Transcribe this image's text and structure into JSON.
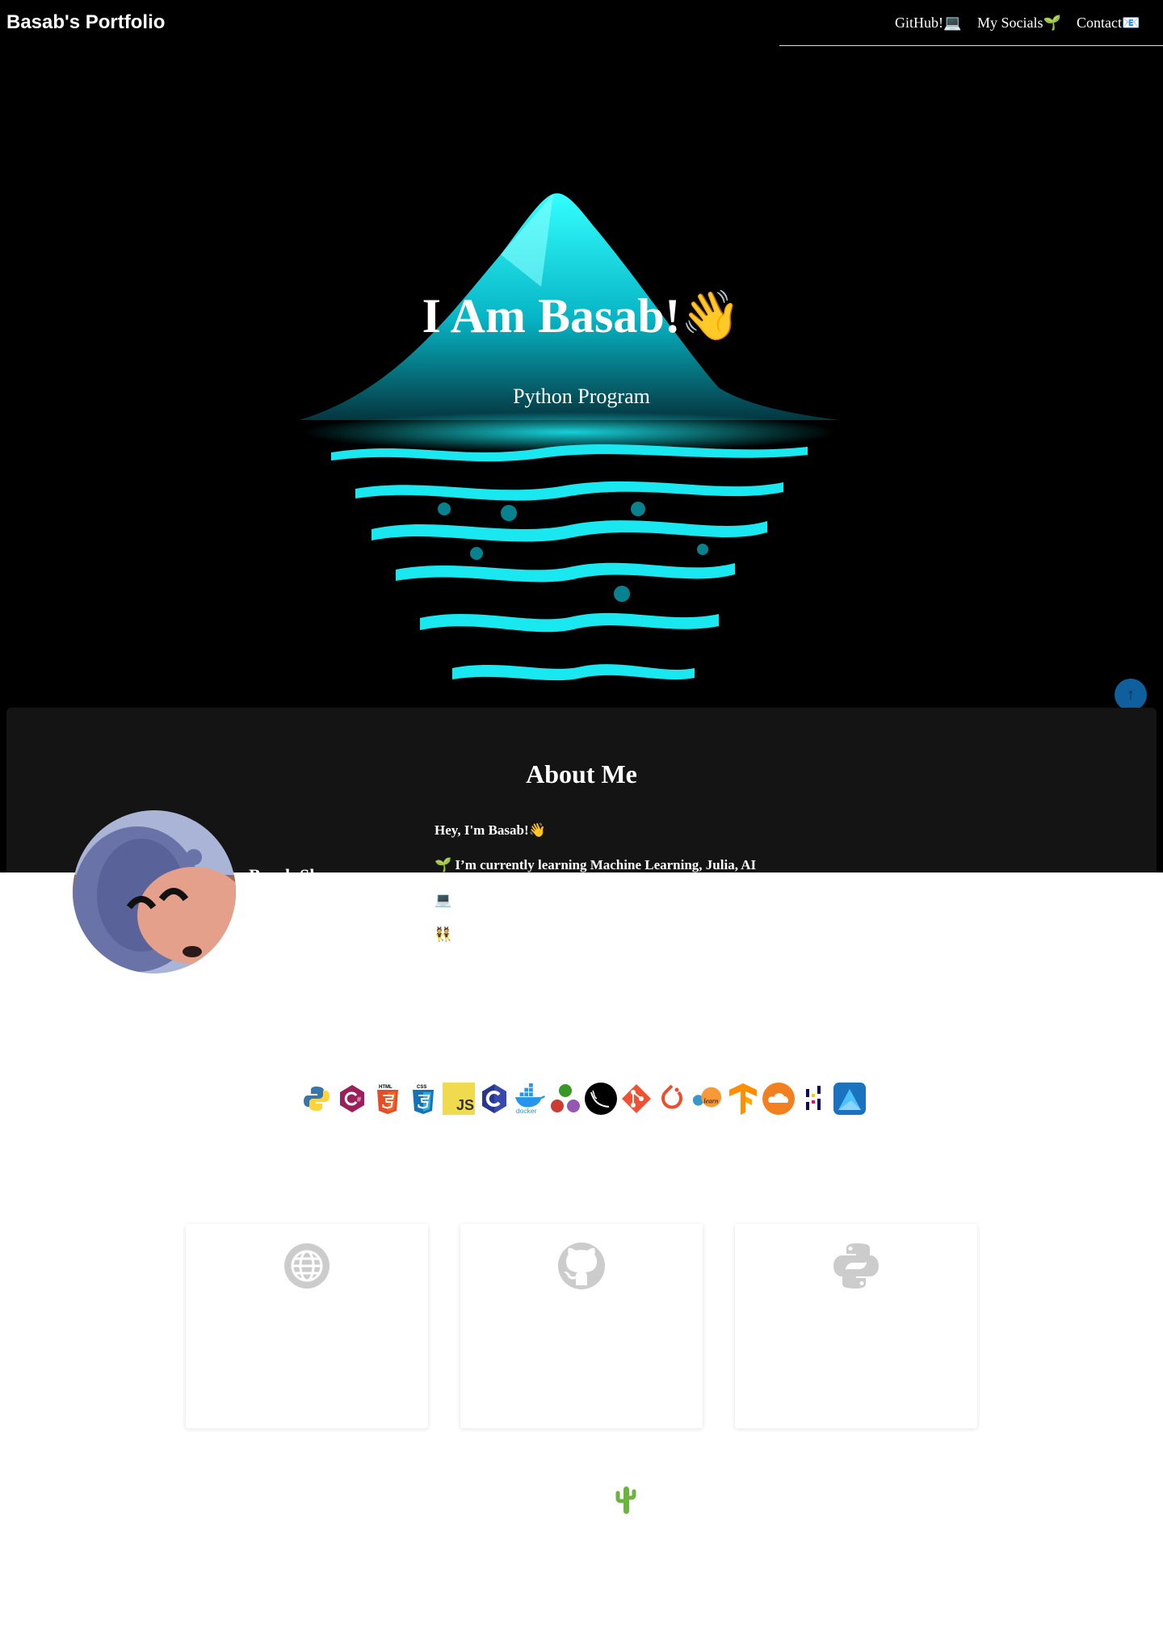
{
  "header": {
    "brand": "Basab's Portfolio",
    "nav": [
      {
        "label": "GitHub!💻"
      },
      {
        "label": "My Socials🌱"
      },
      {
        "label": "Contact📧"
      }
    ]
  },
  "hero": {
    "title": "I Am Basab!👋",
    "subtitle": "Python Program",
    "back_to_top": "↑"
  },
  "about": {
    "heading": "About Me",
    "name_partial": "Basab Sh",
    "lines": [
      "Hey, I'm Basab!👋",
      "🌱 I’m currently learning Machine Learning, Julia, AI",
      "💻",
      "👯"
    ]
  },
  "skills": [
    "python-icon",
    "csharp-icon",
    "html5-icon",
    "css3-icon",
    "javascript-icon",
    "c-icon",
    "docker-icon",
    "julia-icon",
    "flask-icon",
    "git-icon",
    "pytorch-icon",
    "scikit-learn-icon",
    "tensorflow-icon",
    "cloudflare-icon",
    "pandas-icon",
    "affinity-designer-icon"
  ],
  "skill_labels": {
    "html": "HTML",
    "css": "CSS",
    "js": "JS",
    "docker": "docker",
    "learn": "learn"
  },
  "cards": [
    {
      "icon": "globe-icon"
    },
    {
      "icon": "github-icon"
    },
    {
      "icon": "python-icon"
    }
  ],
  "footer": {
    "icon": "cactus-icon"
  },
  "colors": {
    "accent": "#0f5f9c",
    "cyan": "#19f0f0",
    "card_icon": "#cccccc"
  }
}
